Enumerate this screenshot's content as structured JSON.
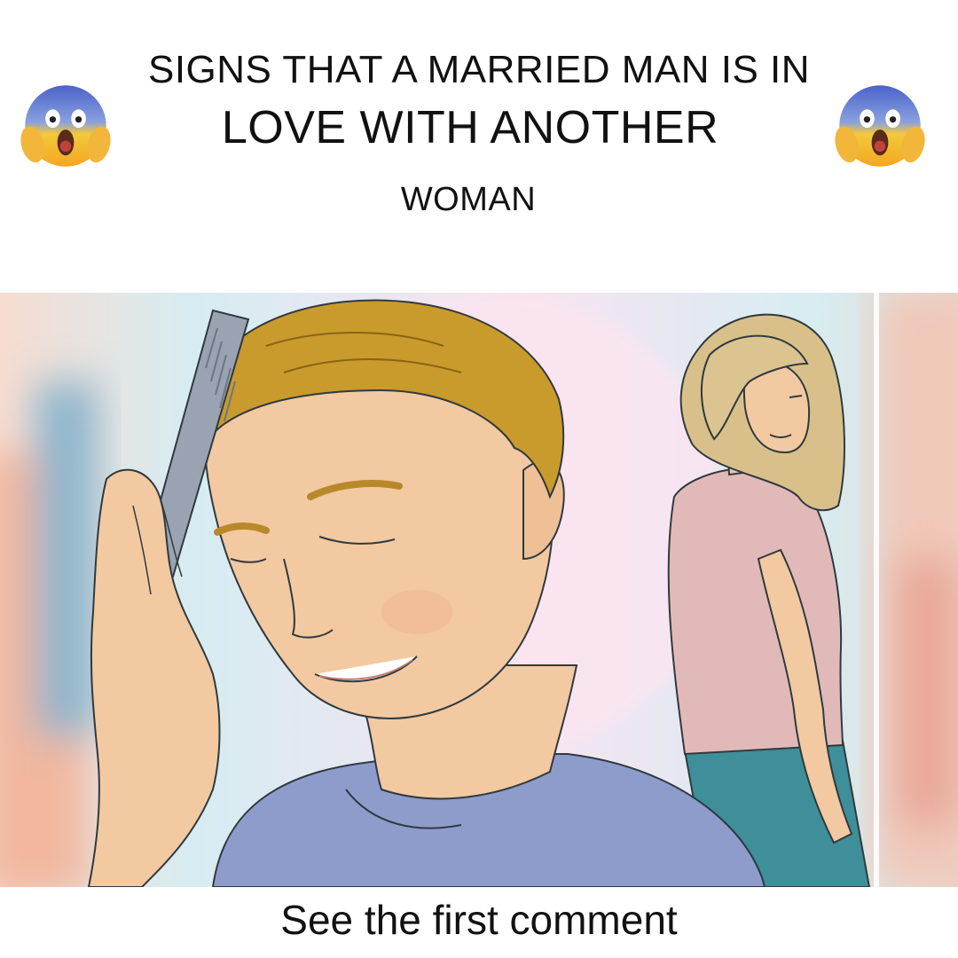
{
  "header": {
    "title_line_1": "SIGNS THAT A MARRIED MAN IS IN",
    "title_line_2": "LOVE WITH ANOTHER",
    "title_line_3": "WOMAN",
    "left_emoji_icon": "face-screaming-in-fear-icon",
    "right_emoji_icon": "face-screaming-in-fear-icon"
  },
  "illustration": {
    "colors": {
      "sky": "#cfe9f4",
      "pink_glow": "#f6dcea",
      "hair_man": "#c99a2c",
      "skin": "#f2c9a0",
      "shirt_man": "#8e9ccc",
      "hair_woman": "#d9c08a",
      "shirt_woman": "#e2b9b9",
      "jeans": "#3e8f9a",
      "comb": "#9aa3b2"
    }
  },
  "footer": {
    "cta_text": "See the first comment"
  }
}
